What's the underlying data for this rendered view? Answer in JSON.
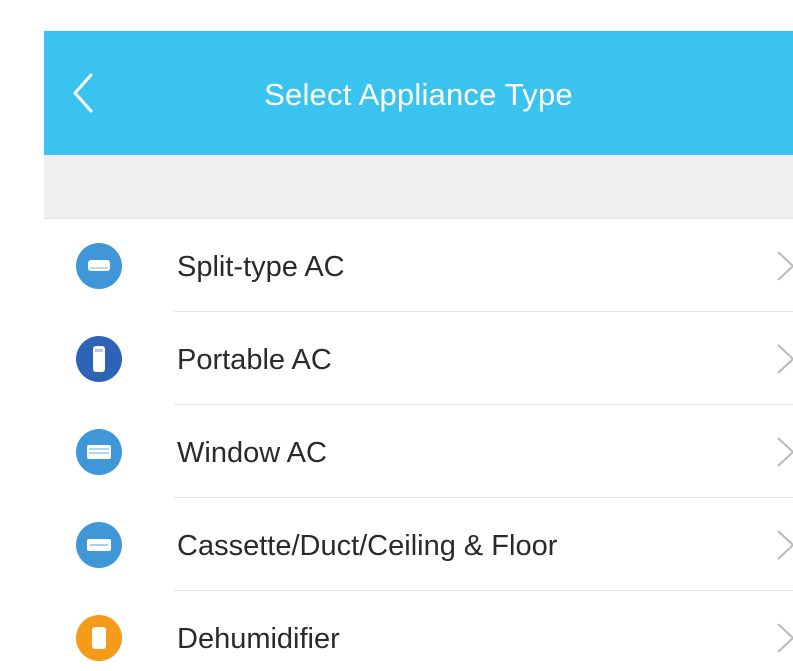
{
  "header": {
    "title": "Select Appliance Type",
    "back_icon": "chevron-left-icon"
  },
  "appliances": [
    {
      "label": "Split-type AC",
      "icon": "split-ac-icon",
      "color": "#3f97d8"
    },
    {
      "label": "Portable AC",
      "icon": "portable-ac-icon",
      "color": "#2f63b5"
    },
    {
      "label": "Window AC",
      "icon": "window-ac-icon",
      "color": "#3f97d8"
    },
    {
      "label": "Cassette/Duct/Ceiling & Floor",
      "icon": "cassette-ac-icon",
      "color": "#3f97d8"
    },
    {
      "label": "Dehumidifier",
      "icon": "dehumidifier-icon",
      "color": "#f59a1b"
    }
  ],
  "colors": {
    "header_bg": "#3bc3f0",
    "band_bg": "#efeff1",
    "text": "#2a2a2a",
    "chevron": "#b9b9bd"
  }
}
